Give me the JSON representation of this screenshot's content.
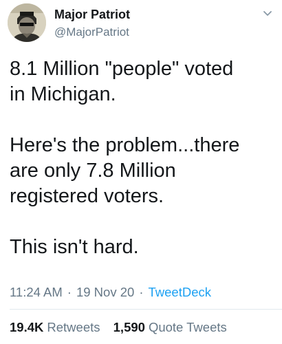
{
  "tweet": {
    "author": {
      "display_name": "Major Patriot",
      "handle": "@MajorPatriot"
    },
    "paragraphs": [
      "8.1 Million \"people\" voted\nin Michigan.",
      "Here's the problem...there\nare only 7.8 Million\nregistered voters.",
      "This isn't hard."
    ],
    "time": "11:24 AM",
    "date": "19 Nov 20",
    "source": "TweetDeck",
    "separator": "·",
    "stats": {
      "retweets_count": "19.4K",
      "retweets_label": "Retweets",
      "quote_count": "1,590",
      "quote_label": "Quote Tweets"
    },
    "icons": {
      "menu": "chevron-down-icon",
      "avatar": "avatar"
    }
  }
}
